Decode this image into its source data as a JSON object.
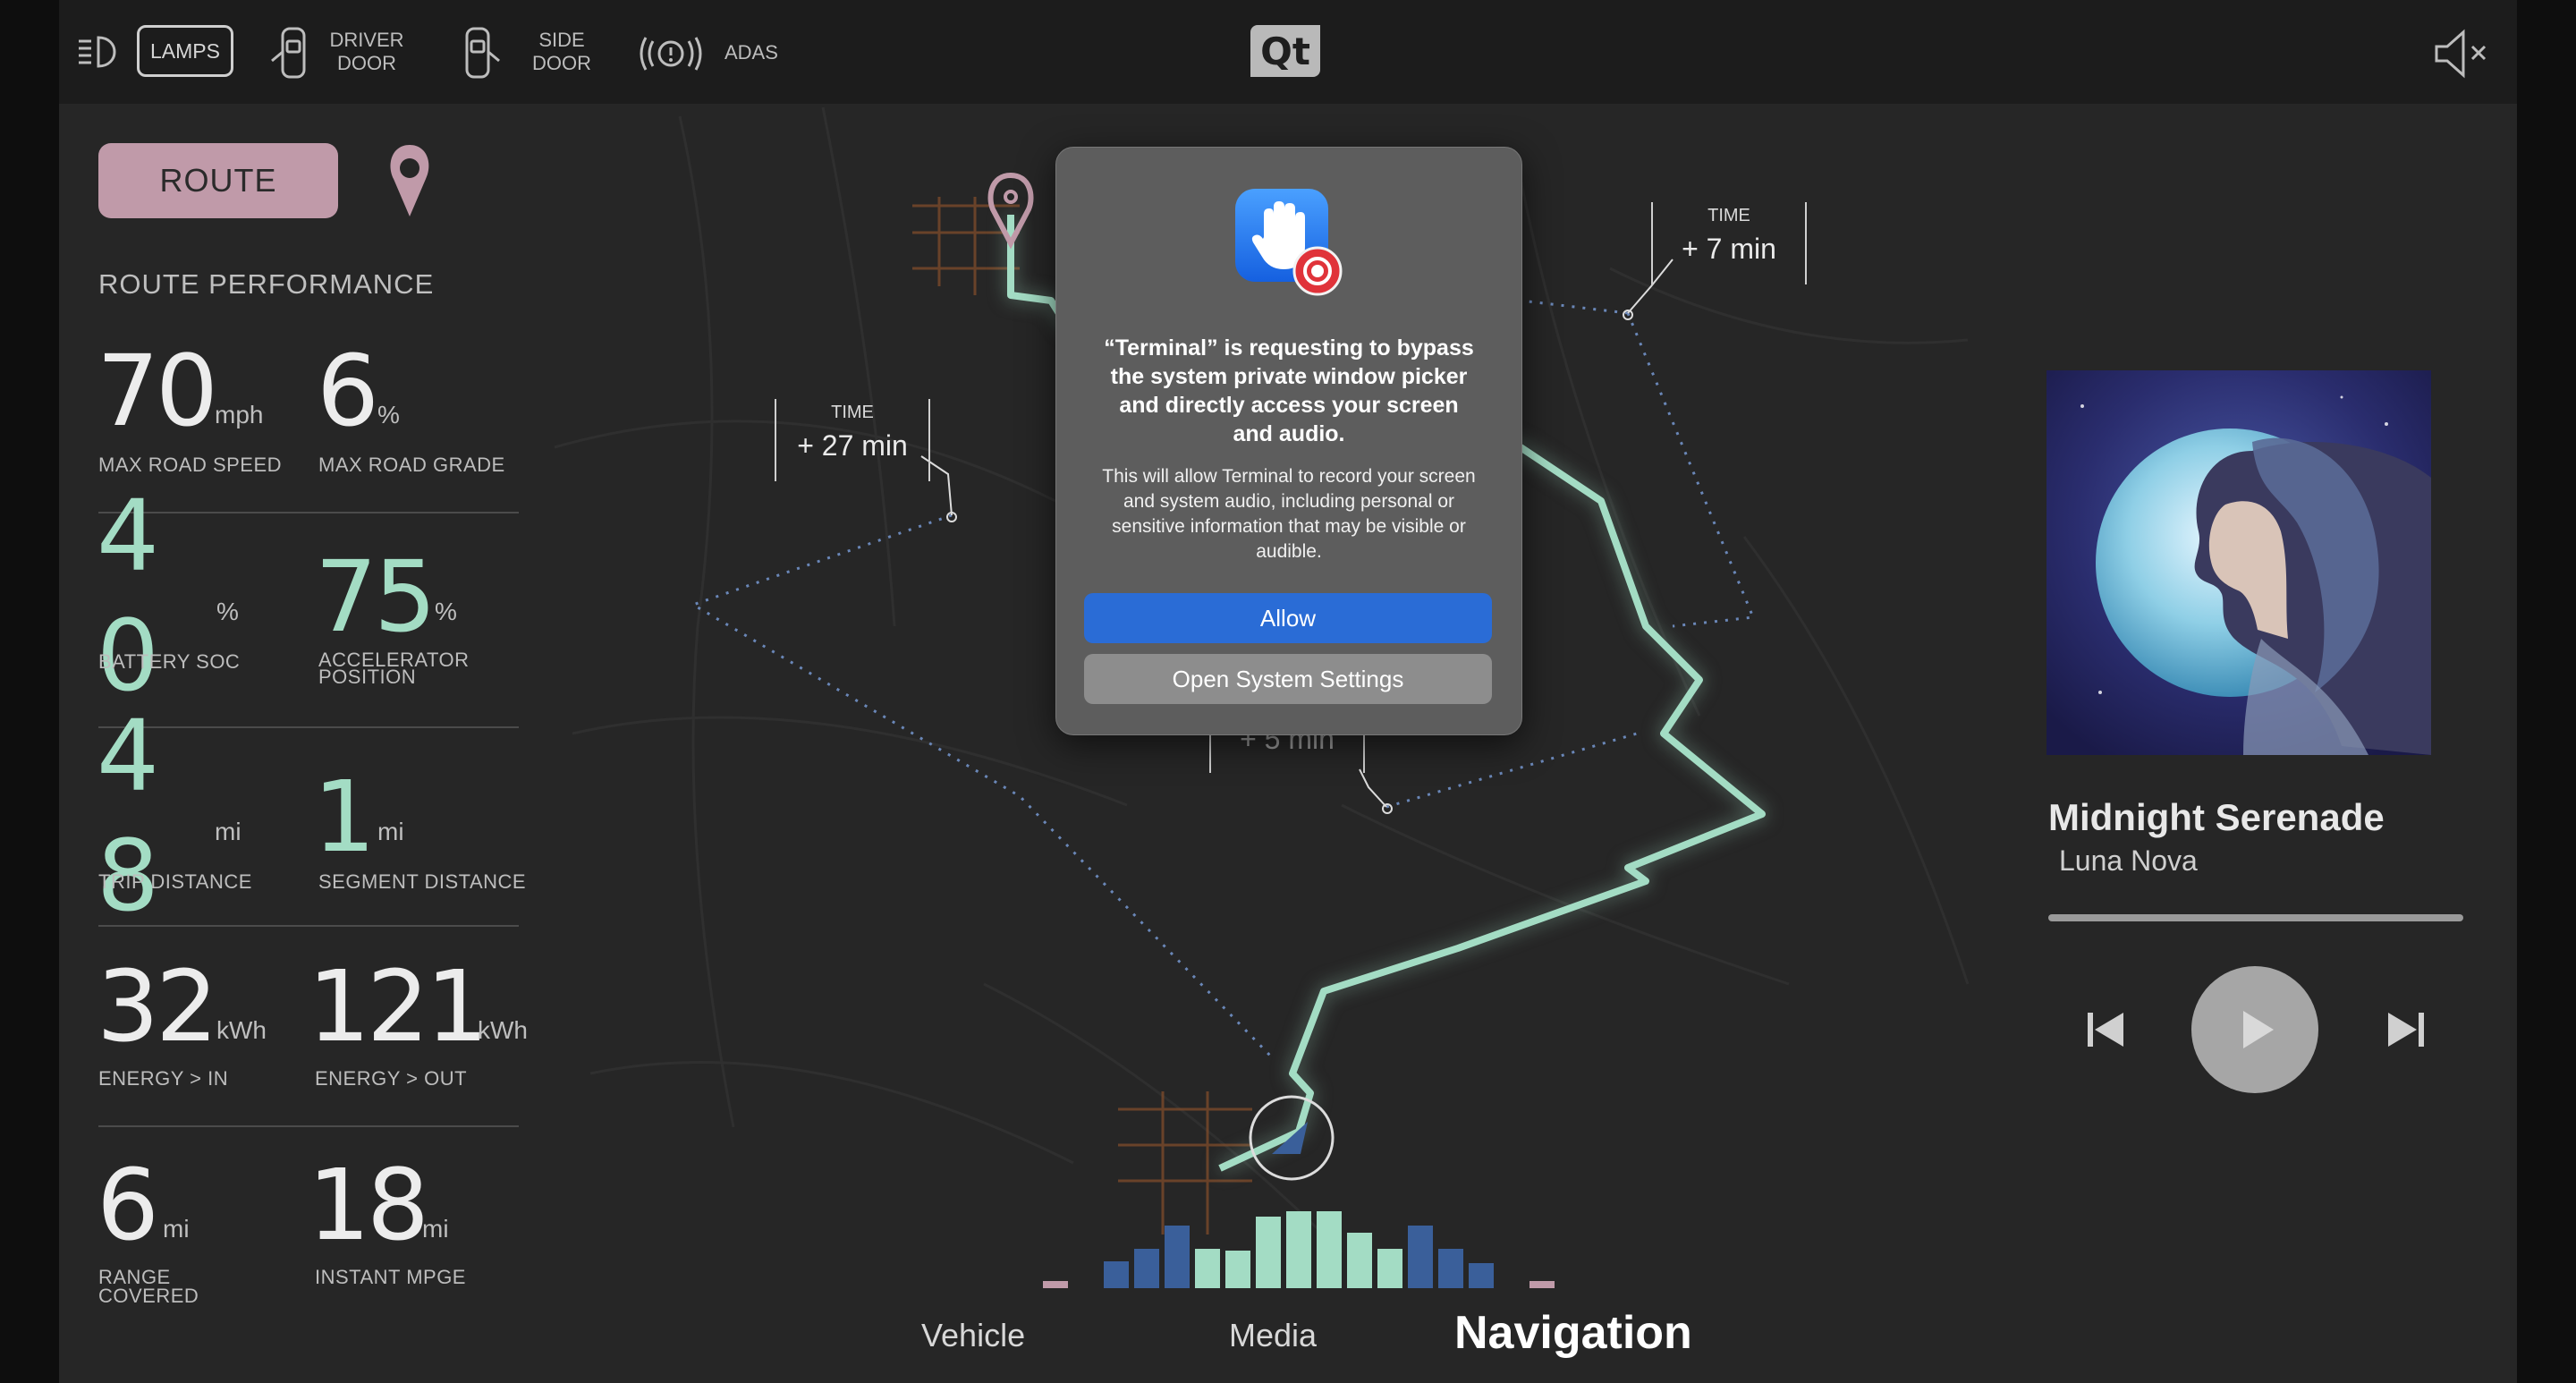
{
  "topbar": {
    "lamps_label": "LAMPS",
    "driver_door_label": [
      "DRIVER",
      "DOOR"
    ],
    "side_door_label": [
      "SIDE",
      "DOOR"
    ],
    "adas_label": "ADAS",
    "logo_text": "Qt"
  },
  "left_panel": {
    "route_button": "ROUTE",
    "section_title": "ROUTE PERFORMANCE",
    "metrics": {
      "max_road_speed": {
        "value": "70",
        "unit": "mph",
        "label": "MAX ROAD SPEED"
      },
      "max_road_grade": {
        "value": "6",
        "unit": "%",
        "label": "MAX ROAD GRADE"
      },
      "battery_soc": {
        "value_top": "4",
        "value_bottom": "0",
        "unit": "%",
        "label": "BATTERY SOC"
      },
      "accelerator_position": {
        "value": "75",
        "unit": "%",
        "label": [
          "ACCELERATOR",
          "POSITION"
        ]
      },
      "trip_distance": {
        "value_top": "4",
        "value_bottom": "8",
        "unit": "mi",
        "label": "TRIP DISTANCE"
      },
      "segment_distance": {
        "value": "1",
        "unit": "mi",
        "label": "SEGMENT DISTANCE"
      },
      "energy_in": {
        "value": "32",
        "unit": "kWh",
        "label": "ENERGY > IN"
      },
      "energy_out": {
        "value": "121",
        "unit": "kWh",
        "label": "ENERGY > OUT"
      },
      "range_covered": {
        "value": "6",
        "unit": "mi",
        "label": [
          "RANGE",
          "COVERED"
        ]
      },
      "instant_mpge": {
        "value": "18",
        "unit": "mi",
        "label": "INSTANT MPGE"
      }
    }
  },
  "map": {
    "callouts": [
      {
        "label": "TIME",
        "value": "+ 27 min"
      },
      {
        "label": "TIME",
        "value": "+ 7 min"
      },
      {
        "label": "",
        "value": "+ 5 min"
      }
    ]
  },
  "dialog": {
    "title": "“Terminal” is requesting to bypass the system private window picker and directly access your screen and audio.",
    "body": "This will allow Terminal to record your screen and system audio, including personal or sensitive information that may be visible or audible.",
    "allow_button": "Allow",
    "settings_button": "Open System Settings"
  },
  "media": {
    "song_title": "Midnight Serenade",
    "artist": "Luna Nova",
    "progress": 0.0
  },
  "bottom_tabs": [
    {
      "label": "Vehicle",
      "active": false
    },
    {
      "label": "Media",
      "active": false
    },
    {
      "label": "Navigation",
      "active": true
    }
  ],
  "colors": {
    "accent_green": "#a3dcc4",
    "route_pink": "#c09aa9",
    "allow_blue": "#2a6cd6",
    "eq_blue": "#3a5f9a"
  },
  "icons": [
    "headlamp-icon",
    "driver-door-icon",
    "side-door-icon",
    "adas-icon",
    "mute-icon",
    "location-pin-icon",
    "hand-stop-icon",
    "previous-icon",
    "play-icon",
    "next-icon"
  ]
}
